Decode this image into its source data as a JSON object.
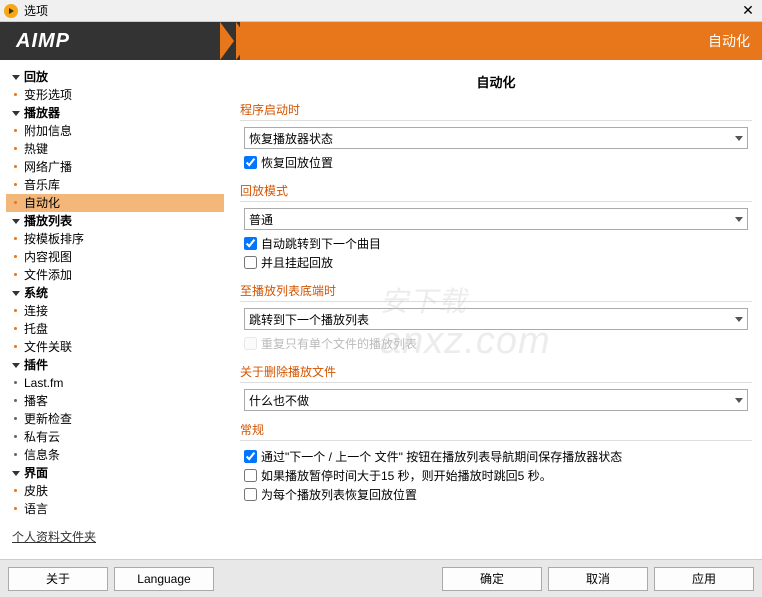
{
  "titlebar": {
    "title": "选项"
  },
  "header": {
    "brand": "AIMP",
    "page": "自动化"
  },
  "sidebar": {
    "items": [
      {
        "label": "回放",
        "type": "parent"
      },
      {
        "label": "变形选项",
        "type": "child"
      },
      {
        "label": "播放器",
        "type": "parent"
      },
      {
        "label": "附加信息",
        "type": "child"
      },
      {
        "label": "热键",
        "type": "child"
      },
      {
        "label": "网络广播",
        "type": "child"
      },
      {
        "label": "音乐库",
        "type": "child"
      },
      {
        "label": "自动化",
        "type": "child",
        "selected": true
      },
      {
        "label": "播放列表",
        "type": "parent"
      },
      {
        "label": "按模板排序",
        "type": "child"
      },
      {
        "label": "内容视图",
        "type": "child"
      },
      {
        "label": "文件添加",
        "type": "child"
      },
      {
        "label": "系统",
        "type": "parent"
      },
      {
        "label": "连接",
        "type": "child"
      },
      {
        "label": "托盘",
        "type": "child"
      },
      {
        "label": "文件关联",
        "type": "child"
      },
      {
        "label": "插件",
        "type": "parent"
      },
      {
        "label": "Last.fm",
        "type": "child sub"
      },
      {
        "label": "播客",
        "type": "child sub"
      },
      {
        "label": "更新检查",
        "type": "child sub"
      },
      {
        "label": "私有云",
        "type": "child sub"
      },
      {
        "label": "信息条",
        "type": "child sub"
      },
      {
        "label": "界面",
        "type": "parent"
      },
      {
        "label": "皮肤",
        "type": "child"
      },
      {
        "label": "语言",
        "type": "child"
      }
    ],
    "profile": "个人资料文件夹"
  },
  "content": {
    "title": "自动化",
    "startup": {
      "label": "程序启动时",
      "select": "恢复播放器状态",
      "cb1": {
        "label": "恢复回放位置",
        "checked": true
      }
    },
    "playback": {
      "label": "回放模式",
      "select": "普通",
      "cb1": {
        "label": "自动跳转到下一个曲目",
        "checked": true
      },
      "cb2": {
        "label": "并且挂起回放",
        "checked": false
      }
    },
    "endlist": {
      "label": "至播放列表底端时",
      "select": "跳转到下一个播放列表",
      "cb1": {
        "label": "重复只有单个文件的播放列表",
        "checked": false,
        "disabled": true
      }
    },
    "deletion": {
      "label": "关于删除播放文件",
      "select": "什么也不做"
    },
    "general": {
      "label": "常规",
      "cb1": {
        "label": "通过\"下一个 / 上一个 文件\" 按钮在播放列表导航期间保存播放器状态",
        "checked": true
      },
      "cb2": {
        "label": "如果播放暂停时间大于15 秒，则开始播放时跳回5 秒。",
        "checked": false
      },
      "cb3": {
        "label": "为每个播放列表恢复回放位置",
        "checked": false
      }
    }
  },
  "footer": {
    "about": "关于",
    "language": "Language",
    "ok": "确定",
    "cancel": "取消",
    "apply": "应用"
  },
  "watermark": {
    "cn": "安下载",
    "en": "anxz.com"
  }
}
